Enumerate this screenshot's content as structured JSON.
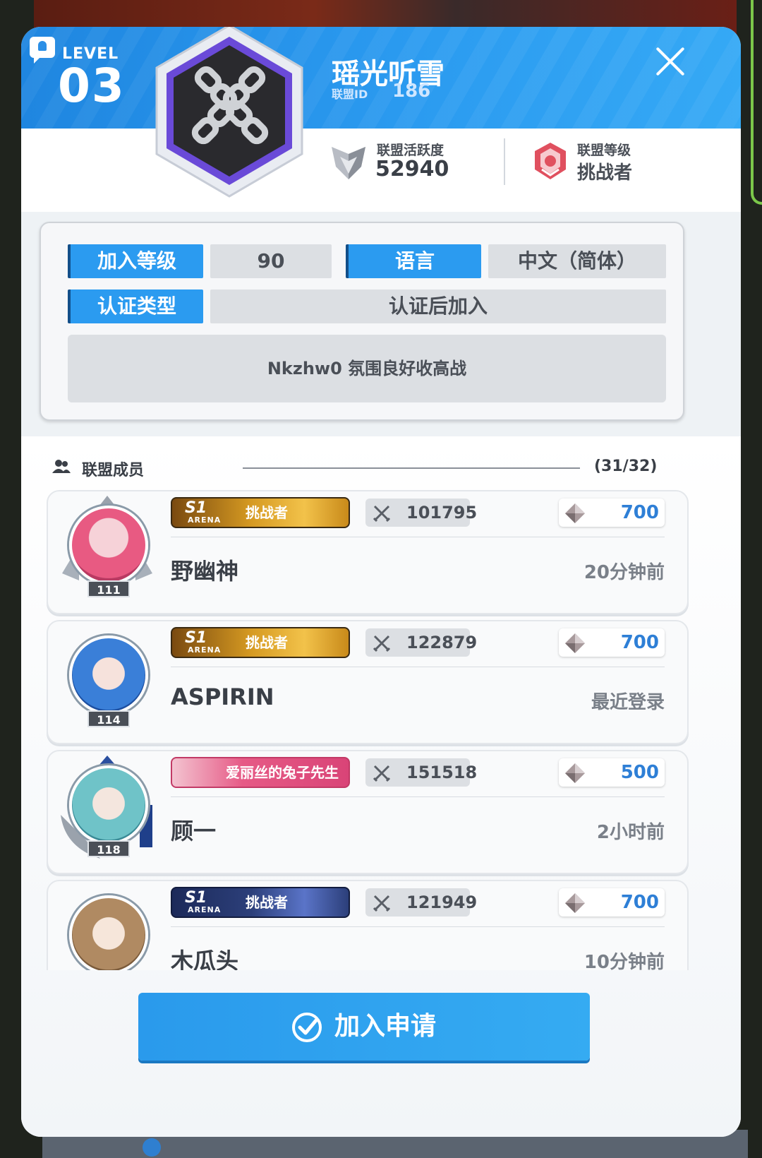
{
  "guild": {
    "level_label": "LEVEL",
    "level": "03",
    "name": "瑶光听雪",
    "id_label": "联盟ID",
    "id": "186",
    "activity_label": "联盟活跃度",
    "activity": "52940",
    "rank_label": "联盟等级",
    "rank": "挑战者"
  },
  "info": {
    "join_level_label": "加入等级",
    "join_level": "90",
    "language_label": "语言",
    "language": "中文（简体）",
    "auth_type_label": "认证类型",
    "auth_type": "认证后加入",
    "description": "Nkzhw0 氛围良好收高战"
  },
  "members_section": {
    "title": "联盟成员",
    "count": "(31/32)"
  },
  "members": [
    {
      "name": "野幽神",
      "level": "111",
      "badge": "挑战者",
      "badge_style": "gold",
      "power": "101795",
      "diamonds": "700",
      "last_seen": "20分钟前"
    },
    {
      "name": "ASPIRIN",
      "level": "114",
      "badge": "挑战者",
      "badge_style": "gold",
      "power": "122879",
      "diamonds": "700",
      "last_seen": "最近登录"
    },
    {
      "name": "顾一",
      "level": "118",
      "badge": "爱丽丝的兔子先生",
      "badge_style": "pink",
      "power": "151518",
      "diamonds": "500",
      "last_seen": "2小时前"
    },
    {
      "name": "木瓜头",
      "level": "",
      "badge": "挑战者",
      "badge_style": "blue",
      "power": "121949",
      "diamonds": "700",
      "last_seen": "10分钟前"
    }
  ],
  "badge_arena": {
    "season": "S1",
    "mode": "ARENA"
  },
  "actions": {
    "join_request": "加入申请"
  },
  "colors": {
    "accent": "#2b9bf0",
    "diamond_value": "#2e7fd6",
    "badge_gold": "#c98a1a",
    "badge_pink": "#e65a86",
    "badge_blue": "#2c3f7a"
  }
}
